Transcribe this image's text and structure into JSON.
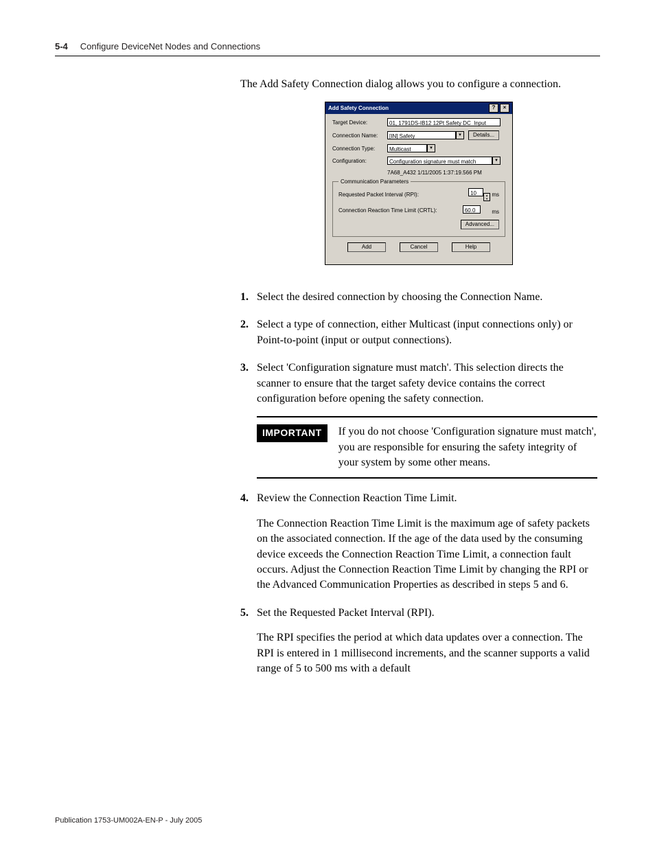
{
  "header": {
    "page_num": "5-4",
    "section_title": "Configure DeviceNet Nodes and Connections"
  },
  "intro": "The Add Safety Connection dialog allows you to configure a connection.",
  "dialog": {
    "title": "Add Safety Connection",
    "help_btn": "?",
    "close_btn": "×",
    "labels": {
      "target_device": "Target Device:",
      "connection_name": "Connection Name:",
      "connection_type": "Connection Type:",
      "configuration": "Configuration:"
    },
    "values": {
      "target_device": "01, 1791DS-IB12 12Pt Safety DC_Input",
      "connection_name": "[IN] Safety",
      "connection_type": "Multicast",
      "configuration": "Configuration signature must match",
      "config_sig_line": "7A68_A432 1/11/2005 1:37:19.566 PM"
    },
    "buttons": {
      "details": "Details...",
      "advanced": "Advanced...",
      "add": "Add",
      "cancel": "Cancel",
      "help": "Help"
    },
    "group_title": "Communication Parameters",
    "rpi_label": "Requested Packet Interval (RPI):",
    "rpi_value": "10",
    "rpi_unit": "ms",
    "crtl_label": "Connection Reaction Time Limit (CRTL):",
    "crtl_value": "60.0",
    "crtl_unit": "ms"
  },
  "steps": {
    "s1": "Select the desired connection by choosing the Connection Name.",
    "s2": "Select a type of connection, either Multicast (input connections only) or Point-to-point (input or output connections).",
    "s3": "Select 'Configuration signature must match'. This selection directs the scanner to ensure that the target safety device contains the correct configuration before opening the safety connection.",
    "important_label": "IMPORTANT",
    "important_text": "If you do not choose 'Configuration signature must match', you are responsible for ensuring the safety integrity of your system by some other means.",
    "s4a": "Review the Connection Reaction Time Limit.",
    "s4b": "The Connection Reaction Time Limit is the maximum age of safety packets on the associated connection. If the age of the data used by the consuming device exceeds the Connection Reaction Time Limit, a connection fault occurs. Adjust the Connection Reaction Time Limit by changing the RPI or the Advanced Communication Properties as described in steps 5 and 6.",
    "s5a": "Set the Requested Packet Interval (RPI).",
    "s5b": "The RPI specifies the period at which data updates over a connection. The RPI is entered in 1 millisecond increments, and the scanner supports a valid range of 5 to 500 ms with a default"
  },
  "footer": "Publication 1753-UM002A-EN-P - July 2005"
}
